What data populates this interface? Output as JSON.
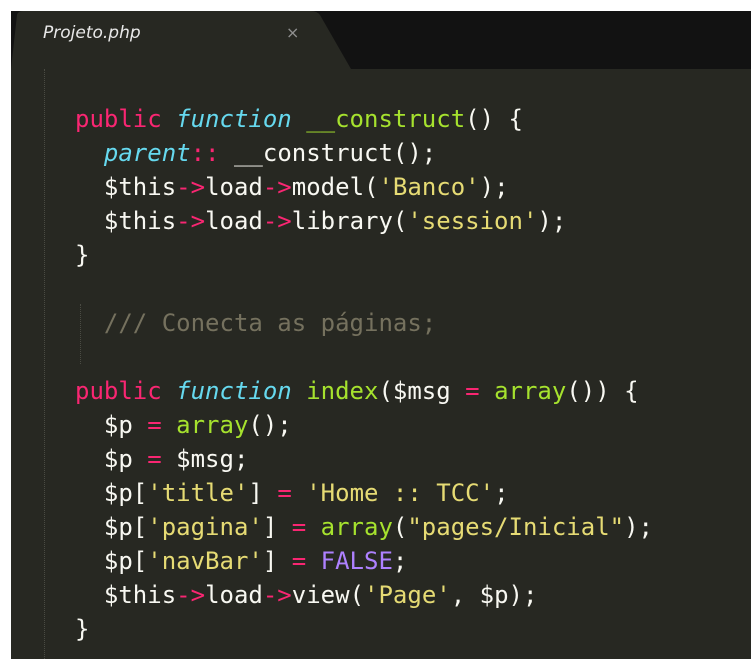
{
  "tab": {
    "filename": "Projeto.php",
    "close_glyph": "×"
  },
  "code": {
    "lines": [
      [
        [
          "kw",
          "public"
        ],
        [
          "pl",
          " "
        ],
        [
          "fn",
          "function"
        ],
        [
          "pl",
          " "
        ],
        [
          "name",
          "__construct"
        ],
        [
          "pl",
          "() {"
        ]
      ],
      [
        [
          "pl",
          "  "
        ],
        [
          "fn",
          "parent"
        ],
        [
          "kw",
          "::"
        ],
        [
          "pl",
          " __construct();"
        ]
      ],
      [
        [
          "pl",
          "  $this"
        ],
        [
          "op",
          "->"
        ],
        [
          "pl",
          "load"
        ],
        [
          "op",
          "->"
        ],
        [
          "pl",
          "model("
        ],
        [
          "str",
          "'Banco'"
        ],
        [
          "pl",
          ");"
        ]
      ],
      [
        [
          "pl",
          "  $this"
        ],
        [
          "op",
          "->"
        ],
        [
          "pl",
          "load"
        ],
        [
          "op",
          "->"
        ],
        [
          "pl",
          "library("
        ],
        [
          "str",
          "'session'"
        ],
        [
          "pl",
          ");"
        ]
      ],
      [
        [
          "pl",
          "}"
        ]
      ],
      [],
      [
        [
          "pl",
          "  "
        ],
        [
          "cm",
          "/// Conecta as páginas;"
        ]
      ],
      [],
      [
        [
          "kw",
          "public"
        ],
        [
          "pl",
          " "
        ],
        [
          "fn",
          "function"
        ],
        [
          "pl",
          " "
        ],
        [
          "name",
          "index"
        ],
        [
          "pl",
          "($msg "
        ],
        [
          "op",
          "="
        ],
        [
          "pl",
          " "
        ],
        [
          "name",
          "array"
        ],
        [
          "pl",
          "()) {"
        ]
      ],
      [
        [
          "pl",
          "  $p "
        ],
        [
          "op",
          "="
        ],
        [
          "pl",
          " "
        ],
        [
          "name",
          "array"
        ],
        [
          "pl",
          "();"
        ]
      ],
      [
        [
          "pl",
          "  $p "
        ],
        [
          "op",
          "="
        ],
        [
          "pl",
          " $msg;"
        ]
      ],
      [
        [
          "pl",
          "  $p["
        ],
        [
          "str",
          "'title'"
        ],
        [
          "pl",
          "] "
        ],
        [
          "op",
          "="
        ],
        [
          "pl",
          " "
        ],
        [
          "str",
          "'Home :: TCC'"
        ],
        [
          "pl",
          ";"
        ]
      ],
      [
        [
          "pl",
          "  $p["
        ],
        [
          "str",
          "'pagina'"
        ],
        [
          "pl",
          "] "
        ],
        [
          "op",
          "="
        ],
        [
          "pl",
          " "
        ],
        [
          "name",
          "array"
        ],
        [
          "pl",
          "("
        ],
        [
          "str",
          "\"pages/Inicial\""
        ],
        [
          "pl",
          ");"
        ]
      ],
      [
        [
          "pl",
          "  $p["
        ],
        [
          "str",
          "'navBar'"
        ],
        [
          "pl",
          "] "
        ],
        [
          "op",
          "="
        ],
        [
          "pl",
          " "
        ],
        [
          "const",
          "FALSE"
        ],
        [
          "pl",
          ";"
        ]
      ],
      [
        [
          "pl",
          "  $this"
        ],
        [
          "op",
          "->"
        ],
        [
          "pl",
          "load"
        ],
        [
          "op",
          "->"
        ],
        [
          "pl",
          "view("
        ],
        [
          "str",
          "'Page'"
        ],
        [
          "pl",
          ", $p);"
        ]
      ],
      [
        [
          "pl",
          "}"
        ]
      ]
    ]
  },
  "colors": {
    "background": "#272822",
    "tabbar": "#121212",
    "keyword": "#f92672",
    "storage": "#66d9ef",
    "function_name": "#a6e22e",
    "string": "#e6db74",
    "comment": "#75715e",
    "constant": "#ae81ff",
    "text": "#f8f8f2"
  }
}
